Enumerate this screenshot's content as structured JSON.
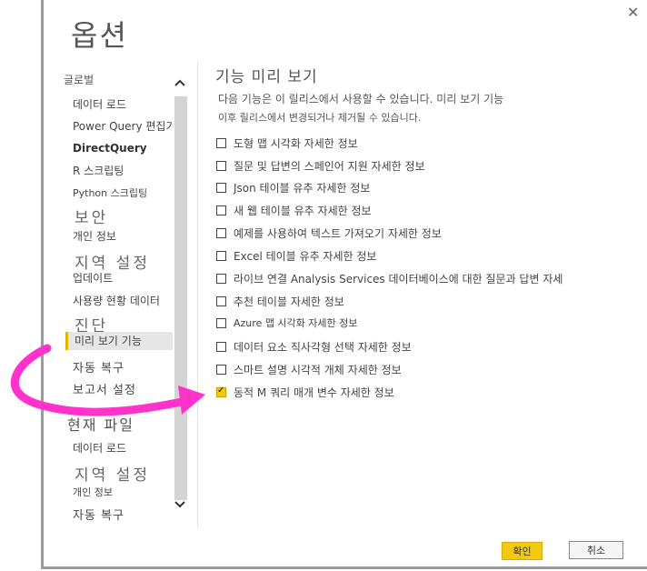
{
  "dialog": {
    "title": "옵션",
    "close_glyph": "✕"
  },
  "sidebar": {
    "global_header": "글로벌",
    "global_items": [
      {
        "label": "데이터 로드"
      },
      {
        "label": "Power Query 편집기"
      },
      {
        "label": "DirectQuery"
      },
      {
        "label": "R 스크립팅"
      },
      {
        "label": "Python 스크립팅"
      },
      {
        "label": "보안"
      },
      {
        "label": "개인 정보"
      },
      {
        "label": "지역 설정"
      },
      {
        "label": "업데이트"
      },
      {
        "label": "사용량 현황 데이터"
      },
      {
        "label": "진단"
      },
      {
        "label": "미리 보기 기능"
      },
      {
        "label": "자동 복구"
      },
      {
        "label": "보고서 설정"
      }
    ],
    "current_header": "현재 파일",
    "current_items": [
      {
        "label": "데이터 로드"
      },
      {
        "label": "지역 설정"
      },
      {
        "label": "개인 정보"
      },
      {
        "label": "자동 복구"
      }
    ],
    "selected": "미리 보기 기능"
  },
  "main": {
    "heading": "기능 미리 보기",
    "desc_line1": "다음 기능은 이 릴리스에서 사용할 수 있습니다. 미리 보기 기능",
    "desc_line2": "이후 릴리스에서 변경되거나 제거될 수 있습니다.",
    "options": [
      {
        "label": "도형 맵 시각화 자세한 정보",
        "checked": false
      },
      {
        "label": "질문 및 답변의 스페인어 지원 자세한 정보",
        "checked": false
      },
      {
        "label": "Json 테이블 유추 자세한 정보",
        "checked": false
      },
      {
        "label": "새 웹 테이블 유추 자세한 정보",
        "checked": false
      },
      {
        "label": "예제를 사용하여 텍스트 가져오기 자세한 정보",
        "checked": false
      },
      {
        "label": "Excel 테이블 유추 자세한 정보",
        "checked": false
      },
      {
        "label": "라이브 연결 Analysis Services 데이터베이스에 대한 질문과 답변 자세",
        "checked": false
      },
      {
        "label": "추천 테이블 자세한 정보",
        "checked": false
      },
      {
        "label": "Azure 맵 시각화 자세한 정보",
        "checked": false
      },
      {
        "label": "데이터 요소 직사각형 선택 자세한 정보",
        "checked": false
      },
      {
        "label": "스마트 설명 시각적 개체 자세한 정보",
        "checked": false
      },
      {
        "label": "동적 M 쿼리 매개 변수 자세한 정보",
        "checked": true
      }
    ]
  },
  "buttons": {
    "ok": "확인",
    "cancel": "취소"
  },
  "colors": {
    "accent": "#f2c811",
    "annotation_arrow": "#ff33cc"
  },
  "icons": {
    "scroll_up": "chevron-up-icon",
    "scroll_down": "chevron-down-icon",
    "close": "close-icon"
  }
}
